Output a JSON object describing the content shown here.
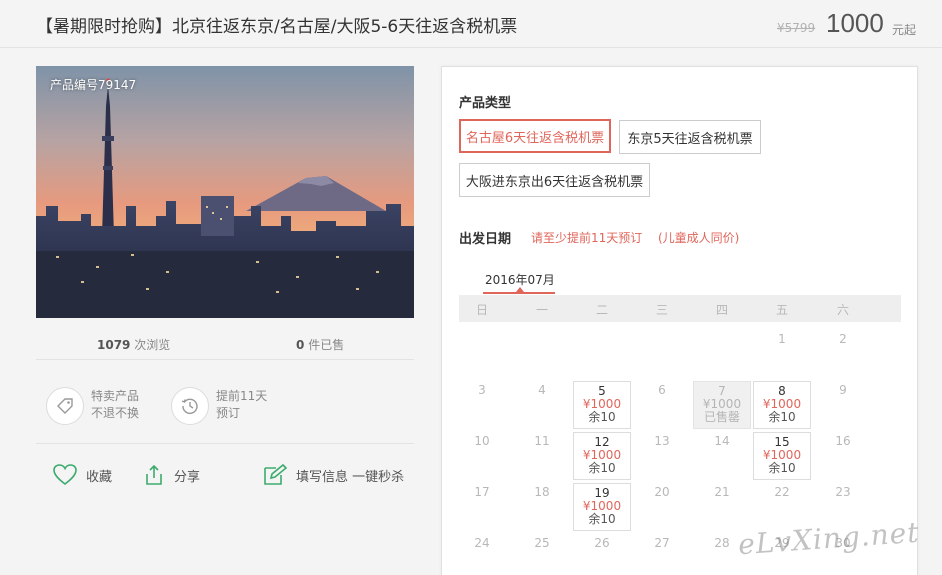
{
  "header": {
    "title": "【暑期限时抢购】北京往返东京/名古屋/大阪5-6天往返含税机票",
    "original_price": "¥5799",
    "price": "1000",
    "price_suffix": "元起"
  },
  "product": {
    "code_label": "产品编号79147",
    "views_count": "1079",
    "views_label": "次浏览",
    "sold_count": "0",
    "sold_label": "件已售"
  },
  "features": [
    {
      "icon": "tag-icon",
      "line1": "特卖产品",
      "line2": "不退不换"
    },
    {
      "icon": "clock-icon",
      "line1": "提前11天",
      "line2": "预订"
    }
  ],
  "actions": {
    "favorite": "收藏",
    "share": "分享",
    "fill_info": "填写信息 一键秒杀"
  },
  "product_type": {
    "label": "产品类型",
    "options": [
      {
        "label": "名古屋6天往返含税机票",
        "selected": true
      },
      {
        "label": "东京5天往返含税机票",
        "selected": false
      },
      {
        "label": "大阪进东京出6天往返含税机票",
        "selected": false
      }
    ]
  },
  "departure": {
    "label": "出发日期",
    "note_advance": "请至少提前11天预订",
    "note_child": "(儿童成人同价)",
    "month": "2016年07月",
    "weekdays": [
      "日",
      "一",
      "二",
      "三",
      "四",
      "五",
      "六"
    ],
    "weeks": [
      [
        null,
        null,
        null,
        null,
        null,
        {
          "day": "1"
        },
        {
          "day": "2"
        }
      ],
      [
        {
          "day": "3"
        },
        {
          "day": "4"
        },
        {
          "day": "5",
          "price": "¥1000",
          "stock": "余10"
        },
        {
          "day": "6"
        },
        {
          "day": "7",
          "price": "¥1000",
          "stock": "已售罄",
          "soldout": true
        },
        {
          "day": "8",
          "price": "¥1000",
          "stock": "余10"
        },
        {
          "day": "9"
        }
      ],
      [
        {
          "day": "10"
        },
        {
          "day": "11"
        },
        {
          "day": "12",
          "price": "¥1000",
          "stock": "余10"
        },
        {
          "day": "13"
        },
        {
          "day": "14"
        },
        {
          "day": "15",
          "price": "¥1000",
          "stock": "余10"
        },
        {
          "day": "16"
        }
      ],
      [
        {
          "day": "17"
        },
        {
          "day": "18"
        },
        {
          "day": "19",
          "price": "¥1000",
          "stock": "余10"
        },
        {
          "day": "20"
        },
        {
          "day": "21"
        },
        {
          "day": "22"
        },
        {
          "day": "23"
        }
      ],
      [
        {
          "day": "24"
        },
        {
          "day": "25"
        },
        {
          "day": "26"
        },
        {
          "day": "27"
        },
        {
          "day": "28"
        },
        {
          "day": "29"
        },
        {
          "day": "30"
        }
      ]
    ]
  },
  "watermark": "eLvXing.net",
  "colors": {
    "accent": "#e0665b",
    "icon_green": "#3dab6e"
  }
}
